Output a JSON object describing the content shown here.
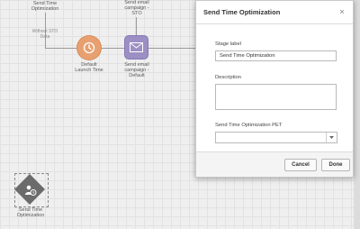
{
  "canvas": {
    "top_left_label": "Send Time\nOptimization",
    "branch_label": "Without STO\nData",
    "top_email_label": "Send email\ncampaign -\nSTO",
    "launch_node_label": "Default\nLaunch Time",
    "email_node_label": "Send email\ncampaign -\nDefault",
    "sto_node_label": "Send Time\nOptimization",
    "launch_node_icon": "clock-icon",
    "email_node_icon": "envelope-icon",
    "sto_node_icon": "person-clock-icon"
  },
  "dialog": {
    "title": "Send Time Optimization",
    "close_symbol": "×",
    "stage_label_label": "Stage label",
    "stage_label_value": "Send Time Optimization",
    "description_label": "Description",
    "pet_label": "Send Time Optimization PET",
    "cancel_label": "Cancel",
    "done_label": "Done"
  },
  "colors": {
    "launch_node": "#e8a070",
    "email_node": "#9c8fc4",
    "sto_node": "#6b6b6b"
  }
}
